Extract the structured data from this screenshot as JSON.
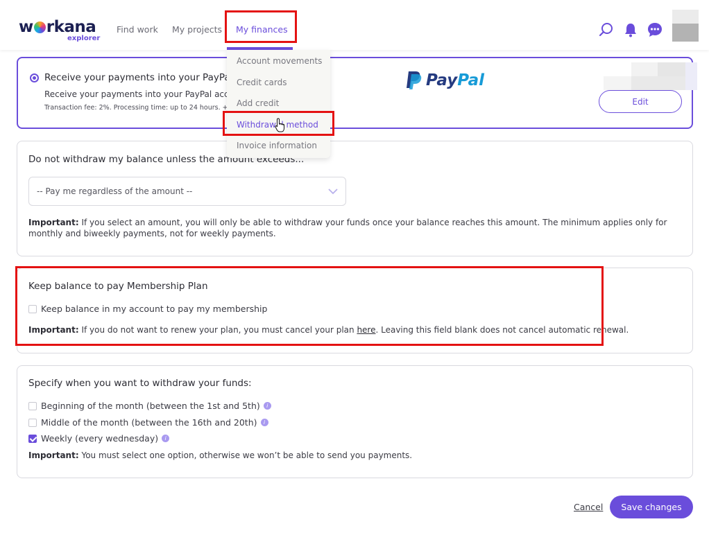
{
  "header": {
    "logo_text_pre": "w",
    "logo_text_post": "rkana",
    "logo_sub": "explorer",
    "nav": [
      "Find work",
      "My projects",
      "My finances"
    ],
    "icons": [
      "search-icon",
      "bell-icon",
      "chat-icon"
    ]
  },
  "dropdown": {
    "items": [
      "Account movements",
      "Credit cards",
      "Add credit",
      "Withdrawal method",
      "Invoice information"
    ],
    "active_index": 3
  },
  "paypal_card": {
    "title": "Receive your payments into your PayPal",
    "description": "Receive your payments into your PayPal accou",
    "fee": "Transaction fee: 2%. Processing time: up to 24 hours. +",
    "logo_pay": "Pay",
    "logo_pal": "Pal",
    "edit_label": "Edit"
  },
  "threshold_card": {
    "heading": "Do not withdraw my balance unless the amount exceeds...",
    "select_value": "-- Pay me regardless of the amount --",
    "note_bold": "Important:",
    "note_text": " If you select an amount, you will only be able to withdraw your funds once your balance reaches this amount. The minimum applies only for monthly and biweekly payments, not for weekly payments."
  },
  "membership_card": {
    "heading": "Keep balance to pay Membership Plan",
    "checkbox_label": "Keep balance in my account to pay my membership",
    "checkbox_checked": false,
    "note_bold": "Important:",
    "note_text_1": " If you do not want to renew your plan, you must cancel your plan ",
    "note_link": "here",
    "note_text_2": ". Leaving this field blank does not cancel automatic renewal."
  },
  "schedule_card": {
    "heading": "Specify when you want to withdraw your funds:",
    "options": [
      {
        "label": "Beginning of the month (between the 1st and 5th)",
        "checked": false
      },
      {
        "label": "Middle of the month (between the 16th and 20th)",
        "checked": false
      },
      {
        "label": "Weekly (every wednesday)",
        "checked": true
      }
    ],
    "info_glyph": "i",
    "note_bold": "Important:",
    "note_text": " You must select one option, otherwise we won’t be able to send you payments."
  },
  "footer": {
    "cancel_label": "Cancel",
    "save_label": "Save changes"
  },
  "colors": {
    "accent": "#6a4ddb",
    "highlight": "#e41212",
    "paypal_dark": "#253b80",
    "paypal_light": "#179bd7"
  }
}
